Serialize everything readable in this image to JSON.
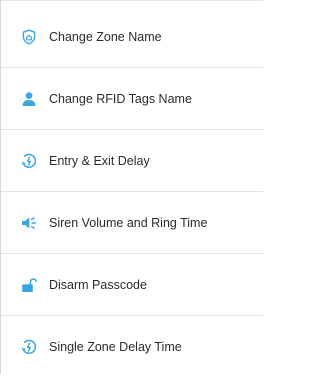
{
  "accent_color": "#3aa6df",
  "menu": {
    "items": [
      {
        "label": "Change Zone Name",
        "icon": "shield-home-icon"
      },
      {
        "label": "Change RFID Tags Name",
        "icon": "person-icon"
      },
      {
        "label": "Entry & Exit Delay",
        "icon": "clock-delay-icon"
      },
      {
        "label": "Siren Volume and Ring Time",
        "icon": "speaker-volume-icon"
      },
      {
        "label": "Disarm Passcode",
        "icon": "unlock-icon"
      },
      {
        "label": "Single Zone Delay Time",
        "icon": "clock-delay-icon"
      }
    ]
  }
}
